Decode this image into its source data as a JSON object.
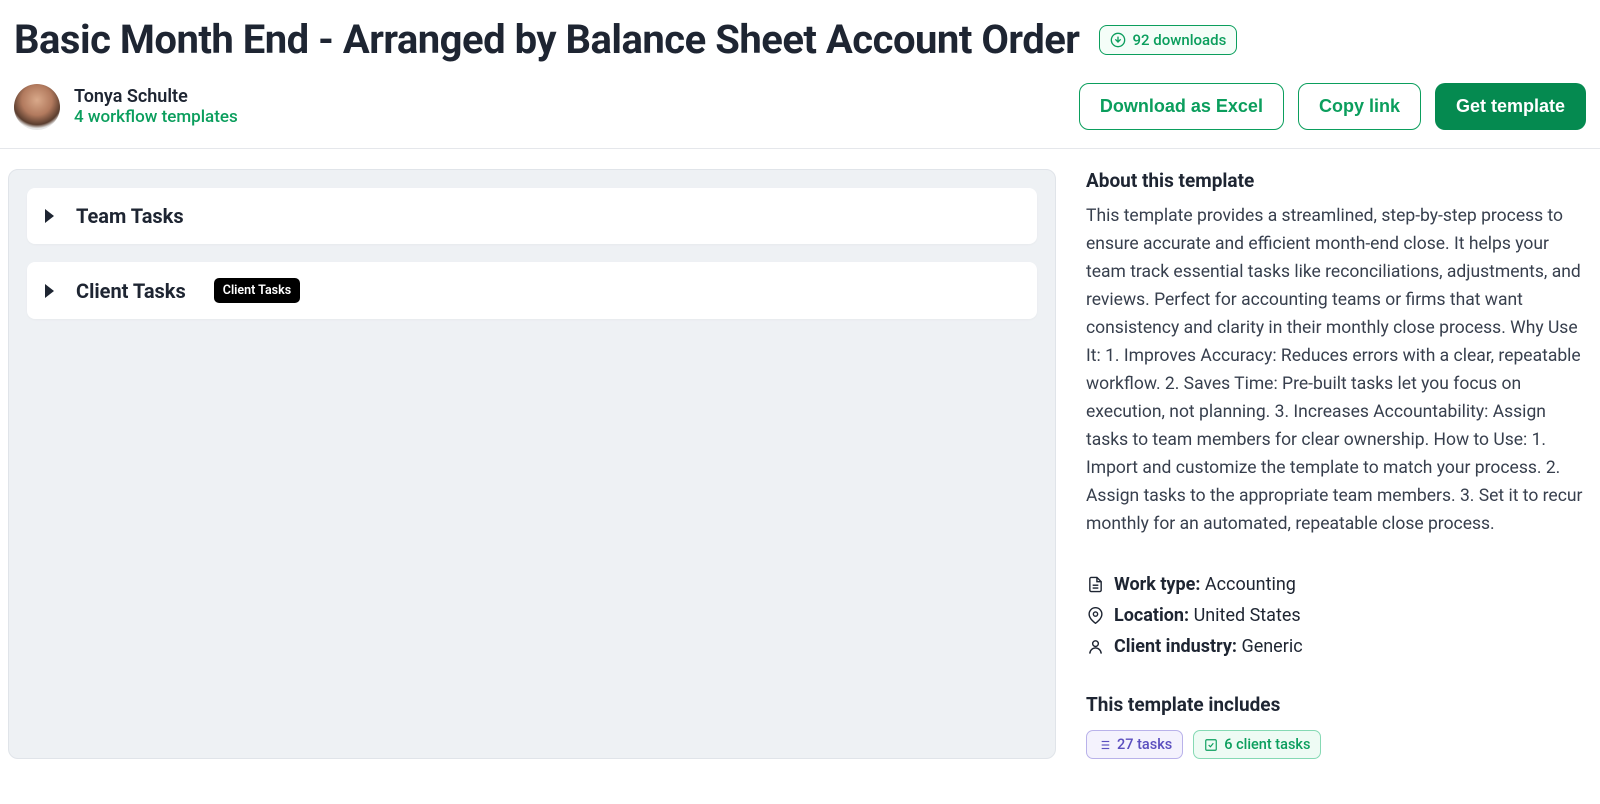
{
  "header": {
    "title": "Basic Month End - Arranged by Balance Sheet Account Order",
    "downloads_label": "92 downloads",
    "author_name": "Tonya Schulte",
    "author_templates": "4 workflow templates",
    "download_excel": "Download as Excel",
    "copy_link": "Copy link",
    "get_template": "Get template"
  },
  "tasks": {
    "team_tasks_title": "Team Tasks",
    "client_tasks_title": "Client Tasks",
    "client_tasks_badge": "Client Tasks"
  },
  "about": {
    "heading": "About this template",
    "body": "This template provides a streamlined, step-by-step process to ensure accurate and efficient month-end close. It helps your team track essential tasks like reconciliations, adjustments, and reviews. Perfect for accounting teams or firms that want consistency and clarity in their monthly close process. Why Use It: 1. Improves Accuracy: Reduces errors with a clear, repeatable workflow. 2. Saves Time: Pre-built tasks let you focus on execution, not planning. 3. Increases Accountability: Assign tasks to team members for clear ownership. How to Use: 1. Import and customize the template to match your process. 2. Assign tasks to the appropriate team members. 3. Set it to recur monthly for an automated, repeatable close process."
  },
  "meta": {
    "work_type_label": "Work type:",
    "work_type_value": "Accounting",
    "location_label": "Location:",
    "location_value": "United States",
    "industry_label": "Client industry:",
    "industry_value": "Generic"
  },
  "includes": {
    "heading": "This template includes",
    "tasks_pill": "27 tasks",
    "client_pill": "6 client tasks"
  }
}
